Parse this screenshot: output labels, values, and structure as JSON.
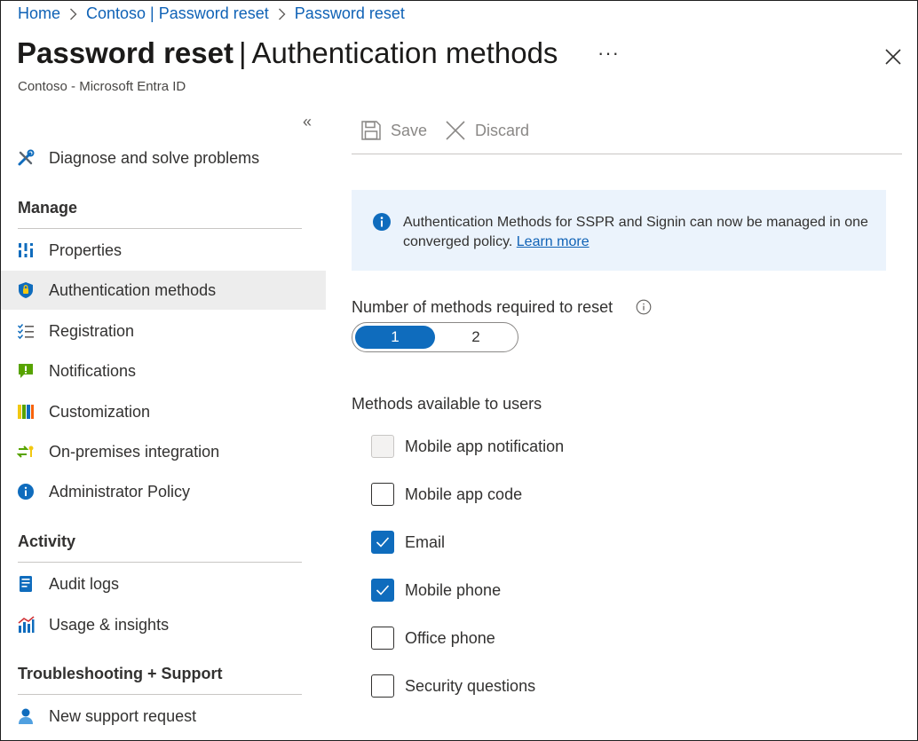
{
  "breadcrumb": [
    "Home",
    "Contoso | Password reset",
    "Password reset"
  ],
  "header": {
    "title_bold": "Password reset",
    "title_sep": "|",
    "title_rest": "Authentication methods",
    "subtitle": "Contoso - Microsoft Entra ID",
    "more": "···",
    "collapse": "«"
  },
  "sidebar": {
    "diagnose": "Diagnose and solve problems",
    "sections": {
      "manage": "Manage",
      "activity": "Activity",
      "support": "Troubleshooting + Support"
    },
    "manage_items": [
      {
        "label": "Properties",
        "icon": "properties-icon"
      },
      {
        "label": "Authentication methods",
        "icon": "shield-key-icon",
        "selected": true
      },
      {
        "label": "Registration",
        "icon": "checklist-icon"
      },
      {
        "label": "Notifications",
        "icon": "notification-icon"
      },
      {
        "label": "Customization",
        "icon": "palette-icon"
      },
      {
        "label": "On-premises integration",
        "icon": "sync-icon"
      },
      {
        "label": "Administrator Policy",
        "icon": "info-icon"
      }
    ],
    "activity_items": [
      {
        "label": "Audit logs",
        "icon": "audit-log-icon"
      },
      {
        "label": "Usage & insights",
        "icon": "chart-icon"
      }
    ],
    "support_items": [
      {
        "label": "New support request",
        "icon": "person-support-icon"
      }
    ]
  },
  "toolbar": {
    "save_label": "Save",
    "discard_label": "Discard"
  },
  "info_banner": {
    "text": "Authentication Methods for SSPR and Signin can now be managed in one converged policy.",
    "link": "Learn more"
  },
  "methods_required": {
    "label": "Number of methods required to reset",
    "options": [
      "1",
      "2"
    ],
    "selected": "1"
  },
  "methods": {
    "label": "Methods available to users",
    "items": [
      {
        "label": "Mobile app notification",
        "state": "disabled"
      },
      {
        "label": "Mobile app code",
        "state": "unchecked"
      },
      {
        "label": "Email",
        "state": "checked"
      },
      {
        "label": "Mobile phone",
        "state": "checked"
      },
      {
        "label": "Office phone",
        "state": "unchecked"
      },
      {
        "label": "Security questions",
        "state": "unchecked"
      }
    ]
  },
  "colors": {
    "link": "#0f62b6",
    "accent": "#0f6cbd",
    "banner_bg": "#ebf3fc",
    "selected_nav_bg": "#ededed"
  }
}
